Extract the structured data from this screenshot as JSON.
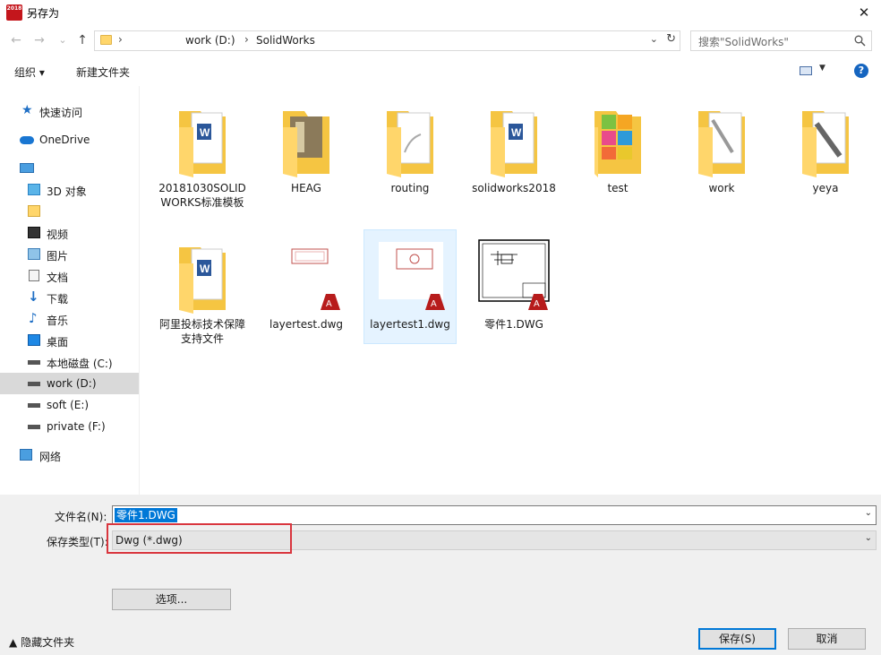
{
  "window": {
    "title": "另存为",
    "app_icon_text": "2018",
    "close_glyph": "✕"
  },
  "nav": {
    "back": "←",
    "forward": "→",
    "recent": "⌄",
    "up": "↑",
    "path": [
      "work (D:)",
      "SolidWorks"
    ],
    "search_placeholder": "搜索\"SolidWorks\""
  },
  "toolbar": {
    "organize": "组织 ▾",
    "new_folder": "新建文件夹",
    "help": "?"
  },
  "sidebar": {
    "items": [
      {
        "label": "快速访问",
        "icon": "star-icon"
      },
      {
        "label": "OneDrive",
        "icon": "cloud-icon"
      },
      {
        "label": "",
        "icon": "computer-icon"
      },
      {
        "label": "3D 对象",
        "icon": "cube-icon"
      },
      {
        "label": "",
        "icon": "user-folder-icon"
      },
      {
        "label": "视频",
        "icon": "video-icon"
      },
      {
        "label": "图片",
        "icon": "picture-icon"
      },
      {
        "label": "文档",
        "icon": "document-icon"
      },
      {
        "label": "下载",
        "icon": "download-icon"
      },
      {
        "label": "音乐",
        "icon": "music-icon"
      },
      {
        "label": "桌面",
        "icon": "desktop-icon"
      },
      {
        "label": "本地磁盘 (C:)",
        "icon": "drive-icon"
      },
      {
        "label": "work (D:)",
        "icon": "drive-icon"
      },
      {
        "label": "soft (E:)",
        "icon": "drive-icon"
      },
      {
        "label": "private (F:)",
        "icon": "drive-icon"
      },
      {
        "label": "网络",
        "icon": "network-icon"
      }
    ]
  },
  "files": [
    {
      "name": "20181030SOLIDWORKS标准模板",
      "kind": "folder",
      "preview": "word"
    },
    {
      "name": "HEAG",
      "kind": "folder",
      "preview": "part"
    },
    {
      "name": "routing",
      "kind": "folder",
      "preview": "pipe"
    },
    {
      "name": "solidworks2018",
      "kind": "folder",
      "preview": "word"
    },
    {
      "name": "test",
      "kind": "folder",
      "preview": "colorful"
    },
    {
      "name": "work",
      "kind": "folder",
      "preview": "tool"
    },
    {
      "name": "yeya",
      "kind": "folder",
      "preview": "tool"
    },
    {
      "name": "阿里投标技术保障支持文件",
      "kind": "folder",
      "preview": "word"
    },
    {
      "name": "layertest.dwg",
      "kind": "dwg",
      "preview": "rect"
    },
    {
      "name": "layertest1.dwg",
      "kind": "dwg",
      "preview": "circle"
    },
    {
      "name": "零件1.DWG",
      "kind": "dwg",
      "preview": "drawing"
    }
  ],
  "form": {
    "filename_label": "文件名(N):",
    "filename_value": "零件1.DWG",
    "filetype_label": "保存类型(T):",
    "filetype_value": "Dwg (*.dwg)",
    "options_button": "选项...",
    "save_button": "保存(S)",
    "cancel_button": "取消",
    "hide_folders": "隐藏文件夹",
    "dropdown_glyph": "⌄"
  },
  "colors": {
    "highlight": "#d9363e",
    "selection": "#0078d7",
    "folder": "#ffd66b"
  }
}
